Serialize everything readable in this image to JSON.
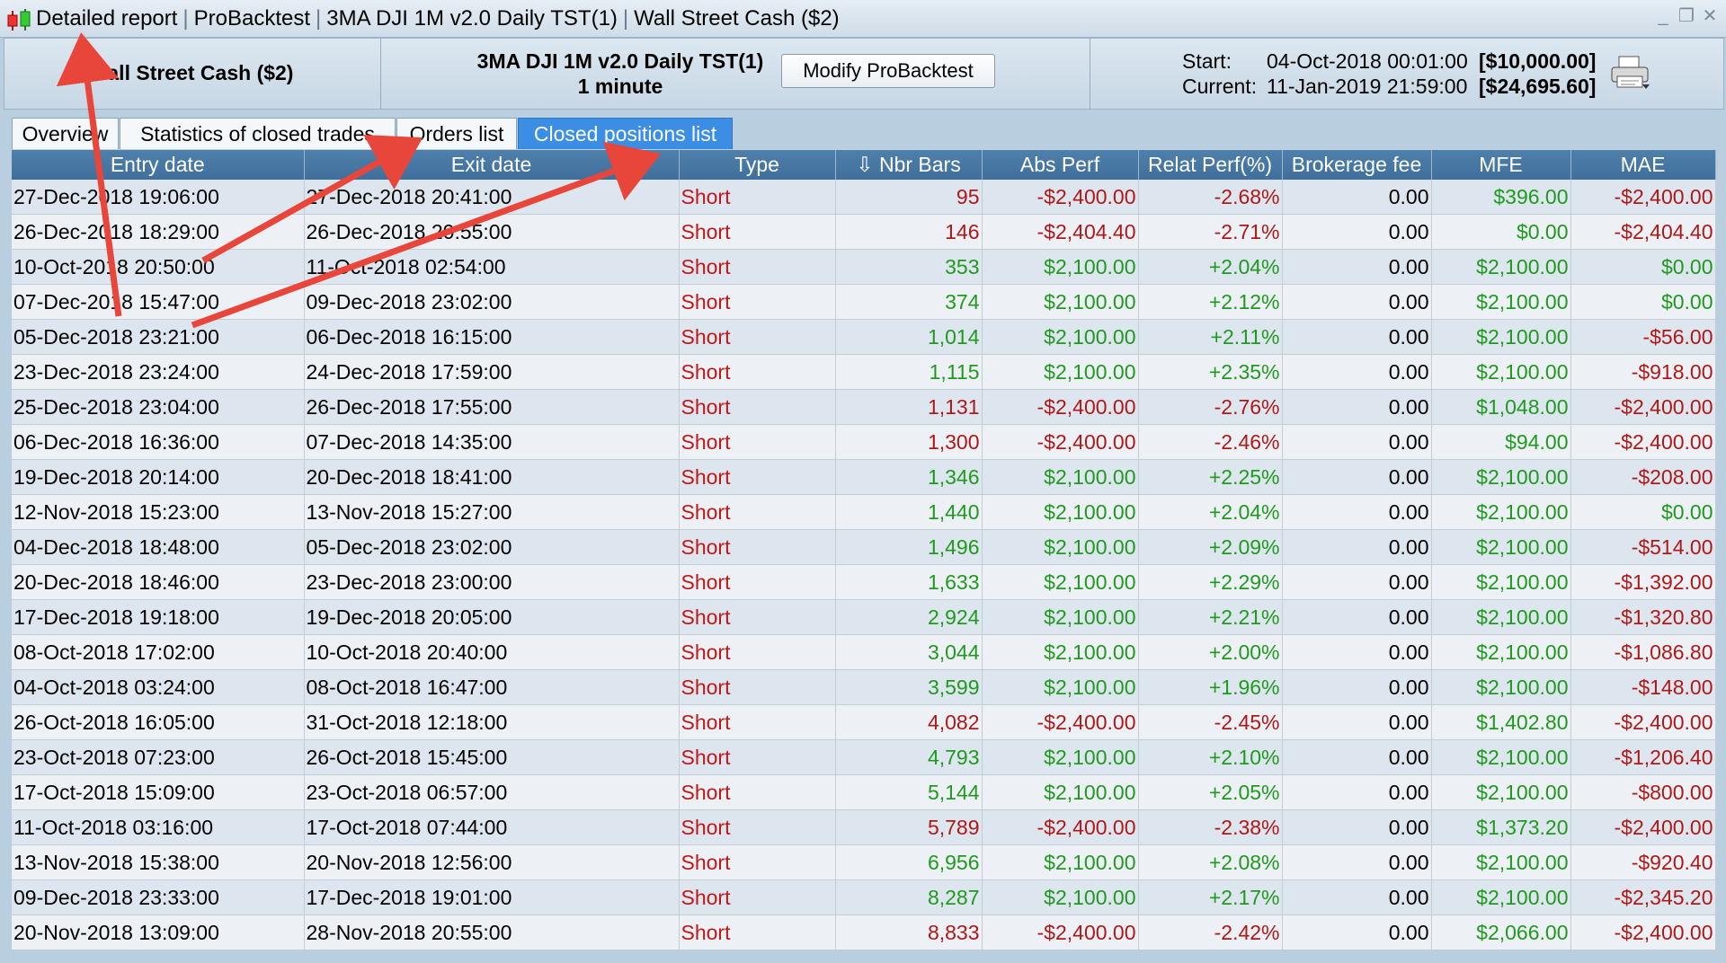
{
  "window": {
    "title_parts": [
      "Detailed report",
      "ProBacktest",
      "3MA DJI 1M v2.0 Daily TST(1)",
      "Wall Street Cash ($2)"
    ],
    "controls": [
      "_",
      "❐",
      "✕"
    ]
  },
  "header": {
    "instrument": "Wall Street Cash ($2)",
    "strategy_name": "3MA DJI 1M v2.0 Daily TST(1)",
    "timeframe": "1 minute",
    "modify_button": "Modify ProBacktest",
    "start_label": "Start:",
    "start_date": "04-Oct-2018 00:01:00",
    "start_capital": "[$10,000.00]",
    "current_label": "Current:",
    "current_date": "11-Jan-2019 21:59:00",
    "current_capital": "[$24,695.60]"
  },
  "tabs": [
    {
      "label": "Overview"
    },
    {
      "label": "Statistics of closed trades"
    },
    {
      "label": "Orders list"
    },
    {
      "label": "Closed positions list"
    }
  ],
  "table": {
    "columns": [
      "Entry date",
      "Exit date",
      "Type",
      "⇩ Nbr Bars",
      "Abs Perf",
      "Relat Perf(%)",
      "Brokerage fee",
      "MFE",
      "MAE"
    ],
    "rows": [
      [
        "27-Dec-2018 19:06:00",
        "27-Dec-2018 20:41:00",
        "Short",
        "95",
        "-$2,400.00",
        "-2.68%",
        "0.00",
        "$396.00",
        "-$2,400.00"
      ],
      [
        "26-Dec-2018 18:29:00",
        "26-Dec-2018 20:55:00",
        "Short",
        "146",
        "-$2,404.40",
        "-2.71%",
        "0.00",
        "$0.00",
        "-$2,404.40"
      ],
      [
        "10-Oct-2018 20:50:00",
        "11-Oct-2018 02:54:00",
        "Short",
        "353",
        "$2,100.00",
        "+2.04%",
        "0.00",
        "$2,100.00",
        "$0.00"
      ],
      [
        "07-Dec-2018 15:47:00",
        "09-Dec-2018 23:02:00",
        "Short",
        "374",
        "$2,100.00",
        "+2.12%",
        "0.00",
        "$2,100.00",
        "$0.00"
      ],
      [
        "05-Dec-2018 23:21:00",
        "06-Dec-2018 16:15:00",
        "Short",
        "1,014",
        "$2,100.00",
        "+2.11%",
        "0.00",
        "$2,100.00",
        "-$56.00"
      ],
      [
        "23-Dec-2018 23:24:00",
        "24-Dec-2018 17:59:00",
        "Short",
        "1,115",
        "$2,100.00",
        "+2.35%",
        "0.00",
        "$2,100.00",
        "-$918.00"
      ],
      [
        "25-Dec-2018 23:04:00",
        "26-Dec-2018 17:55:00",
        "Short",
        "1,131",
        "-$2,400.00",
        "-2.76%",
        "0.00",
        "$1,048.00",
        "-$2,400.00"
      ],
      [
        "06-Dec-2018 16:36:00",
        "07-Dec-2018 14:35:00",
        "Short",
        "1,300",
        "-$2,400.00",
        "-2.46%",
        "0.00",
        "$94.00",
        "-$2,400.00"
      ],
      [
        "19-Dec-2018 20:14:00",
        "20-Dec-2018 18:41:00",
        "Short",
        "1,346",
        "$2,100.00",
        "+2.25%",
        "0.00",
        "$2,100.00",
        "-$208.00"
      ],
      [
        "12-Nov-2018 15:23:00",
        "13-Nov-2018 15:27:00",
        "Short",
        "1,440",
        "$2,100.00",
        "+2.04%",
        "0.00",
        "$2,100.00",
        "$0.00"
      ],
      [
        "04-Dec-2018 18:48:00",
        "05-Dec-2018 23:02:00",
        "Short",
        "1,496",
        "$2,100.00",
        "+2.09%",
        "0.00",
        "$2,100.00",
        "-$514.00"
      ],
      [
        "20-Dec-2018 18:46:00",
        "23-Dec-2018 23:00:00",
        "Short",
        "1,633",
        "$2,100.00",
        "+2.29%",
        "0.00",
        "$2,100.00",
        "-$1,392.00"
      ],
      [
        "17-Dec-2018 19:18:00",
        "19-Dec-2018 20:05:00",
        "Short",
        "2,924",
        "$2,100.00",
        "+2.21%",
        "0.00",
        "$2,100.00",
        "-$1,320.80"
      ],
      [
        "08-Oct-2018 17:02:00",
        "10-Oct-2018 20:40:00",
        "Short",
        "3,044",
        "$2,100.00",
        "+2.00%",
        "0.00",
        "$2,100.00",
        "-$1,086.80"
      ],
      [
        "04-Oct-2018 03:24:00",
        "08-Oct-2018 16:47:00",
        "Short",
        "3,599",
        "$2,100.00",
        "+1.96%",
        "0.00",
        "$2,100.00",
        "-$148.00"
      ],
      [
        "26-Oct-2018 16:05:00",
        "31-Oct-2018 12:18:00",
        "Short",
        "4,082",
        "-$2,400.00",
        "-2.45%",
        "0.00",
        "$1,402.80",
        "-$2,400.00"
      ],
      [
        "23-Oct-2018 07:23:00",
        "26-Oct-2018 15:45:00",
        "Short",
        "4,793",
        "$2,100.00",
        "+2.10%",
        "0.00",
        "$2,100.00",
        "-$1,206.40"
      ],
      [
        "17-Oct-2018 15:09:00",
        "23-Oct-2018 06:57:00",
        "Short",
        "5,144",
        "$2,100.00",
        "+2.05%",
        "0.00",
        "$2,100.00",
        "-$800.00"
      ],
      [
        "11-Oct-2018 03:16:00",
        "17-Oct-2018 07:44:00",
        "Short",
        "5,789",
        "-$2,400.00",
        "-2.38%",
        "0.00",
        "$1,373.20",
        "-$2,400.00"
      ],
      [
        "13-Nov-2018 15:38:00",
        "20-Nov-2018 12:56:00",
        "Short",
        "6,956",
        "$2,100.00",
        "+2.08%",
        "0.00",
        "$2,100.00",
        "-$920.40"
      ],
      [
        "09-Dec-2018 23:33:00",
        "17-Dec-2018 19:01:00",
        "Short",
        "8,287",
        "$2,100.00",
        "+2.17%",
        "0.00",
        "$2,100.00",
        "-$2,345.20"
      ],
      [
        "20-Nov-2018 13:09:00",
        "28-Nov-2018 20:55:00",
        "Short",
        "8,833",
        "-$2,400.00",
        "-2.42%",
        "0.00",
        "$2,066.00",
        "-$2,400.00"
      ]
    ]
  },
  "colors": {
    "positive": "#1f9a1f",
    "negative": "#b01818",
    "active_tab": "#3b8ee4",
    "table_header": "#4677a3",
    "annotation_arrow": "#e8463a"
  }
}
